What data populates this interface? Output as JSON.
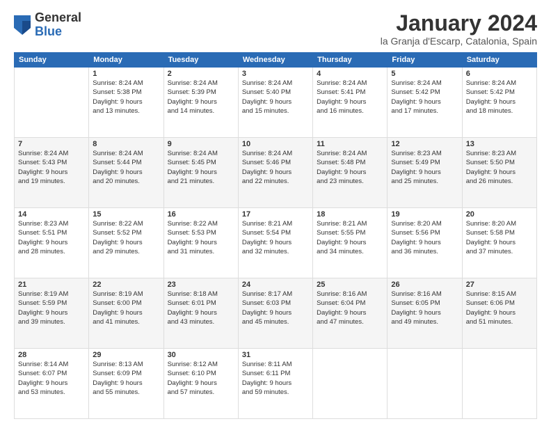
{
  "logo": {
    "general": "General",
    "blue": "Blue"
  },
  "title": "January 2024",
  "location": "la Granja d'Escarp, Catalonia, Spain",
  "days_of_week": [
    "Sunday",
    "Monday",
    "Tuesday",
    "Wednesday",
    "Thursday",
    "Friday",
    "Saturday"
  ],
  "weeks": [
    [
      {
        "day": "",
        "sunrise": "",
        "sunset": "",
        "daylight": ""
      },
      {
        "day": "1",
        "sunrise": "Sunrise: 8:24 AM",
        "sunset": "Sunset: 5:38 PM",
        "daylight": "Daylight: 9 hours and 13 minutes."
      },
      {
        "day": "2",
        "sunrise": "Sunrise: 8:24 AM",
        "sunset": "Sunset: 5:39 PM",
        "daylight": "Daylight: 9 hours and 14 minutes."
      },
      {
        "day": "3",
        "sunrise": "Sunrise: 8:24 AM",
        "sunset": "Sunset: 5:40 PM",
        "daylight": "Daylight: 9 hours and 15 minutes."
      },
      {
        "day": "4",
        "sunrise": "Sunrise: 8:24 AM",
        "sunset": "Sunset: 5:41 PM",
        "daylight": "Daylight: 9 hours and 16 minutes."
      },
      {
        "day": "5",
        "sunrise": "Sunrise: 8:24 AM",
        "sunset": "Sunset: 5:42 PM",
        "daylight": "Daylight: 9 hours and 17 minutes."
      },
      {
        "day": "6",
        "sunrise": "Sunrise: 8:24 AM",
        "sunset": "Sunset: 5:42 PM",
        "daylight": "Daylight: 9 hours and 18 minutes."
      }
    ],
    [
      {
        "day": "7",
        "sunrise": "Sunrise: 8:24 AM",
        "sunset": "Sunset: 5:43 PM",
        "daylight": "Daylight: 9 hours and 19 minutes."
      },
      {
        "day": "8",
        "sunrise": "Sunrise: 8:24 AM",
        "sunset": "Sunset: 5:44 PM",
        "daylight": "Daylight: 9 hours and 20 minutes."
      },
      {
        "day": "9",
        "sunrise": "Sunrise: 8:24 AM",
        "sunset": "Sunset: 5:45 PM",
        "daylight": "Daylight: 9 hours and 21 minutes."
      },
      {
        "day": "10",
        "sunrise": "Sunrise: 8:24 AM",
        "sunset": "Sunset: 5:46 PM",
        "daylight": "Daylight: 9 hours and 22 minutes."
      },
      {
        "day": "11",
        "sunrise": "Sunrise: 8:24 AM",
        "sunset": "Sunset: 5:48 PM",
        "daylight": "Daylight: 9 hours and 23 minutes."
      },
      {
        "day": "12",
        "sunrise": "Sunrise: 8:23 AM",
        "sunset": "Sunset: 5:49 PM",
        "daylight": "Daylight: 9 hours and 25 minutes."
      },
      {
        "day": "13",
        "sunrise": "Sunrise: 8:23 AM",
        "sunset": "Sunset: 5:50 PM",
        "daylight": "Daylight: 9 hours and 26 minutes."
      }
    ],
    [
      {
        "day": "14",
        "sunrise": "Sunrise: 8:23 AM",
        "sunset": "Sunset: 5:51 PM",
        "daylight": "Daylight: 9 hours and 28 minutes."
      },
      {
        "day": "15",
        "sunrise": "Sunrise: 8:22 AM",
        "sunset": "Sunset: 5:52 PM",
        "daylight": "Daylight: 9 hours and 29 minutes."
      },
      {
        "day": "16",
        "sunrise": "Sunrise: 8:22 AM",
        "sunset": "Sunset: 5:53 PM",
        "daylight": "Daylight: 9 hours and 31 minutes."
      },
      {
        "day": "17",
        "sunrise": "Sunrise: 8:21 AM",
        "sunset": "Sunset: 5:54 PM",
        "daylight": "Daylight: 9 hours and 32 minutes."
      },
      {
        "day": "18",
        "sunrise": "Sunrise: 8:21 AM",
        "sunset": "Sunset: 5:55 PM",
        "daylight": "Daylight: 9 hours and 34 minutes."
      },
      {
        "day": "19",
        "sunrise": "Sunrise: 8:20 AM",
        "sunset": "Sunset: 5:56 PM",
        "daylight": "Daylight: 9 hours and 36 minutes."
      },
      {
        "day": "20",
        "sunrise": "Sunrise: 8:20 AM",
        "sunset": "Sunset: 5:58 PM",
        "daylight": "Daylight: 9 hours and 37 minutes."
      }
    ],
    [
      {
        "day": "21",
        "sunrise": "Sunrise: 8:19 AM",
        "sunset": "Sunset: 5:59 PM",
        "daylight": "Daylight: 9 hours and 39 minutes."
      },
      {
        "day": "22",
        "sunrise": "Sunrise: 8:19 AM",
        "sunset": "Sunset: 6:00 PM",
        "daylight": "Daylight: 9 hours and 41 minutes."
      },
      {
        "day": "23",
        "sunrise": "Sunrise: 8:18 AM",
        "sunset": "Sunset: 6:01 PM",
        "daylight": "Daylight: 9 hours and 43 minutes."
      },
      {
        "day": "24",
        "sunrise": "Sunrise: 8:17 AM",
        "sunset": "Sunset: 6:03 PM",
        "daylight": "Daylight: 9 hours and 45 minutes."
      },
      {
        "day": "25",
        "sunrise": "Sunrise: 8:16 AM",
        "sunset": "Sunset: 6:04 PM",
        "daylight": "Daylight: 9 hours and 47 minutes."
      },
      {
        "day": "26",
        "sunrise": "Sunrise: 8:16 AM",
        "sunset": "Sunset: 6:05 PM",
        "daylight": "Daylight: 9 hours and 49 minutes."
      },
      {
        "day": "27",
        "sunrise": "Sunrise: 8:15 AM",
        "sunset": "Sunset: 6:06 PM",
        "daylight": "Daylight: 9 hours and 51 minutes."
      }
    ],
    [
      {
        "day": "28",
        "sunrise": "Sunrise: 8:14 AM",
        "sunset": "Sunset: 6:07 PM",
        "daylight": "Daylight: 9 hours and 53 minutes."
      },
      {
        "day": "29",
        "sunrise": "Sunrise: 8:13 AM",
        "sunset": "Sunset: 6:09 PM",
        "daylight": "Daylight: 9 hours and 55 minutes."
      },
      {
        "day": "30",
        "sunrise": "Sunrise: 8:12 AM",
        "sunset": "Sunset: 6:10 PM",
        "daylight": "Daylight: 9 hours and 57 minutes."
      },
      {
        "day": "31",
        "sunrise": "Sunrise: 8:11 AM",
        "sunset": "Sunset: 6:11 PM",
        "daylight": "Daylight: 9 hours and 59 minutes."
      },
      {
        "day": "",
        "sunrise": "",
        "sunset": "",
        "daylight": ""
      },
      {
        "day": "",
        "sunrise": "",
        "sunset": "",
        "daylight": ""
      },
      {
        "day": "",
        "sunrise": "",
        "sunset": "",
        "daylight": ""
      }
    ]
  ]
}
